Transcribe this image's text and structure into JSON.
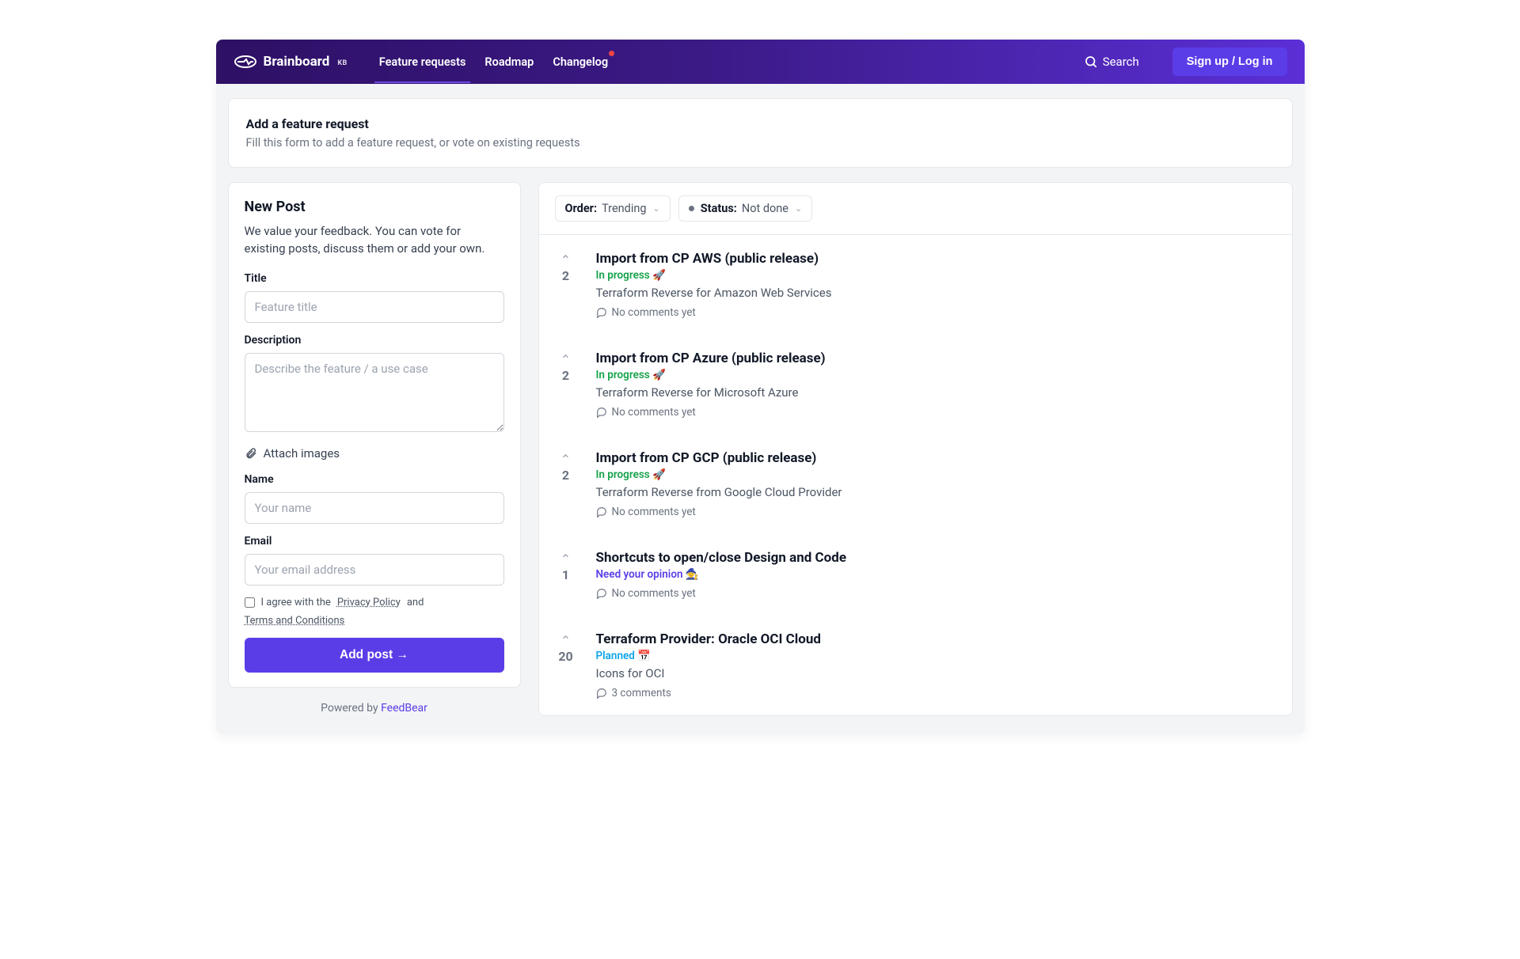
{
  "nav": {
    "brand": "Brainboard",
    "brand_badge": "KB",
    "links": [
      {
        "label": "Feature requests",
        "active": true,
        "notify": false
      },
      {
        "label": "Roadmap",
        "active": false,
        "notify": false
      },
      {
        "label": "Changelog",
        "active": false,
        "notify": true
      }
    ],
    "search_label": "Search",
    "signup_label": "Sign up / Log in"
  },
  "hero": {
    "title": "Add a feature request",
    "subtitle": "Fill this form to add a feature request, or vote on existing requests"
  },
  "form": {
    "heading": "New Post",
    "description": "We value your feedback. You can vote for existing posts, discuss them or add your own.",
    "title_label": "Title",
    "title_placeholder": "Feature title",
    "desc_label": "Description",
    "desc_placeholder": "Describe the feature / a use case",
    "attach_label": "Attach images",
    "name_label": "Name",
    "name_placeholder": "Your name",
    "email_label": "Email",
    "email_placeholder": "Your email address",
    "consent_prefix": "I agree with the",
    "privacy_link": "Privacy Policy",
    "consent_middle": "and",
    "terms_link": "Terms and Conditions",
    "submit_label": "Add post →"
  },
  "footer": {
    "powered_prefix": "Powered by ",
    "powered_brand": "FeedBear"
  },
  "filters": {
    "order_label": "Order:",
    "order_value": "Trending",
    "status_label": "Status:",
    "status_value": "Not done"
  },
  "posts": [
    {
      "votes": "2",
      "title": "Import from CP AWS (public release)",
      "status_text": "In progress 🚀",
      "status_class": "inprog",
      "desc": "Terraform Reverse for Amazon Web Services",
      "comments": "No comments yet"
    },
    {
      "votes": "2",
      "title": "Import from CP Azure (public release)",
      "status_text": "In progress 🚀",
      "status_class": "inprog",
      "desc": "Terraform Reverse for Microsoft Azure",
      "comments": "No comments yet"
    },
    {
      "votes": "2",
      "title": "Import from CP GCP (public release)",
      "status_text": "In progress 🚀",
      "status_class": "inprog",
      "desc": "Terraform Reverse from Google Cloud Provider",
      "comments": "No comments yet"
    },
    {
      "votes": "1",
      "title": "Shortcuts to open/close Design and Code",
      "status_text": "Need your opinion 🧙",
      "status_class": "opinion",
      "desc": "",
      "comments": "No comments yet"
    },
    {
      "votes": "20",
      "title": "Terraform Provider: Oracle OCI Cloud",
      "status_text": "Planned 📅",
      "status_class": "planned",
      "desc": "Icons for OCI",
      "comments": "3 comments"
    }
  ]
}
